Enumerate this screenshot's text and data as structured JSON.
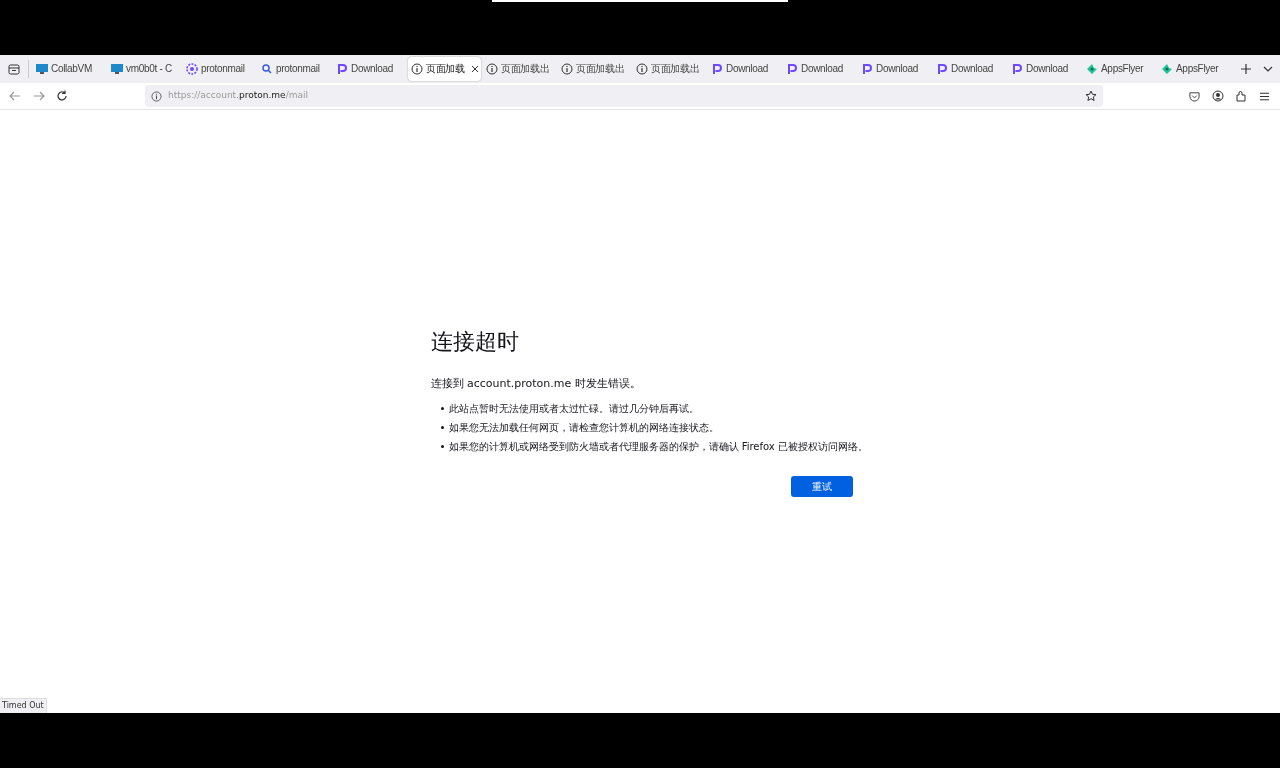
{
  "tabs": [
    {
      "kind": "monitor",
      "title": "CollabVM",
      "selected": false
    },
    {
      "kind": "monitor",
      "title": "vm0b0t - C",
      "selected": false
    },
    {
      "kind": "flower",
      "title": "protonmail",
      "selected": false
    },
    {
      "kind": "search",
      "title": "protonmail",
      "selected": false
    },
    {
      "kind": "p-logo",
      "title": "Download",
      "selected": false
    },
    {
      "kind": "info",
      "title": "页面加载",
      "selected": true
    },
    {
      "kind": "info",
      "title": "页面加载出",
      "selected": false
    },
    {
      "kind": "info",
      "title": "页面加载出",
      "selected": false
    },
    {
      "kind": "info",
      "title": "页面加载出",
      "selected": false
    },
    {
      "kind": "p-logo",
      "title": "Download",
      "selected": false
    },
    {
      "kind": "p-logo",
      "title": "Download",
      "selected": false
    },
    {
      "kind": "p-logo",
      "title": "Download",
      "selected": false
    },
    {
      "kind": "p-logo",
      "title": "Download",
      "selected": false
    },
    {
      "kind": "p-logo",
      "title": "Download",
      "selected": false
    },
    {
      "kind": "leaf",
      "title": "AppsFlyer",
      "selected": false
    },
    {
      "kind": "leaf",
      "title": "AppsFlyer",
      "selected": false
    }
  ],
  "address_bar": {
    "scheme": "https://account.",
    "domain": "proton.me",
    "path": "/mail"
  },
  "error_page": {
    "title": "连接超时",
    "message": "连接到 account.proton.me 时发生错误。",
    "bullets": [
      "此站点暂时无法使用或者太过忙碌。请过几分钟后再试。",
      "如果您无法加载任何网页，请检查您计算机的网络连接状态。",
      "如果您的计算机或网络受到防火墙或者代理服务器的保护，请确认 Firefox 已被授权访问网络。"
    ],
    "button": "重试"
  },
  "status_bar": "Timed Out"
}
